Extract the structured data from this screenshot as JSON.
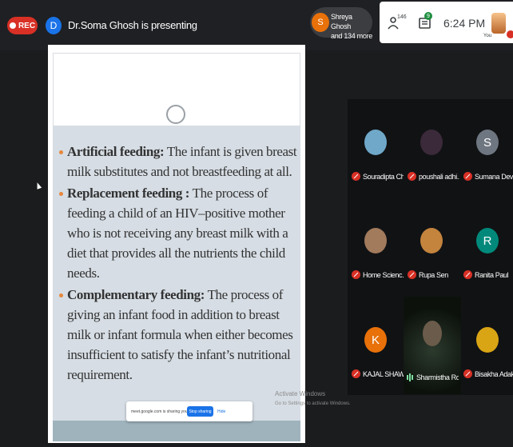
{
  "topbar": {
    "rec_label": "REC",
    "presenter_initial": "D",
    "presenting_text": "Dr.Soma Ghosh is presenting",
    "host_initial": "S",
    "host_line1": "Shreya Ghosh",
    "host_line2": "and 134 more",
    "participant_count": "146",
    "chat_badge": "9",
    "time": "6:24 PM",
    "you_label": "You"
  },
  "slide": {
    "bullets": [
      {
        "term": "Artificial feeding:",
        "text": " The infant is given breast milk substitutes and not breastfeeding at all."
      },
      {
        "term": "Replacement feeding :",
        "text": " The process of feeding a child of an HIV–positive mother who is not receiving any breast milk with a diet that provides all the nutrients the child needs."
      },
      {
        "term": "Complementary feeding:",
        "text": " The process of giving an infant food in addition to breast milk or infant formula when either becomes insufficient to satisfy the infant’s nutritional requirement."
      }
    ],
    "share_bar": {
      "text": "meet.google.com is sharing your screen.",
      "stop_label": "Stop sharing",
      "hide_label": "Hide"
    }
  },
  "watermark": {
    "title": "Activate Windows",
    "sub": "Go to Settings to activate Windows."
  },
  "participants": [
    {
      "name": "Souradipta Ch...",
      "initial": "",
      "color": "#6fa8c9",
      "status": "muted"
    },
    {
      "name": "poushali adhi...",
      "initial": "",
      "color": "#3b2a3a",
      "status": "muted"
    },
    {
      "name": "Sumana Dev ...",
      "initial": "S",
      "color": "#6e7681",
      "status": "muted"
    },
    {
      "name": "Home Scienc...",
      "initial": "",
      "color": "#a27a5c",
      "status": "muted"
    },
    {
      "name": "Rupa Sen",
      "initial": "",
      "color": "#c4843e",
      "status": "muted"
    },
    {
      "name": "Ranita Paul",
      "initial": "R",
      "color": "#00897b",
      "status": "muted"
    },
    {
      "name": "KAJAL SHAW",
      "initial": "K",
      "color": "#e8710a",
      "status": "muted"
    },
    {
      "name": "Sharmistha Roy",
      "initial": "",
      "color": "#2c3a2d",
      "status": "talking"
    },
    {
      "name": "Bisakha Adak",
      "initial": "",
      "color": "#d9a514",
      "status": "muted"
    }
  ]
}
